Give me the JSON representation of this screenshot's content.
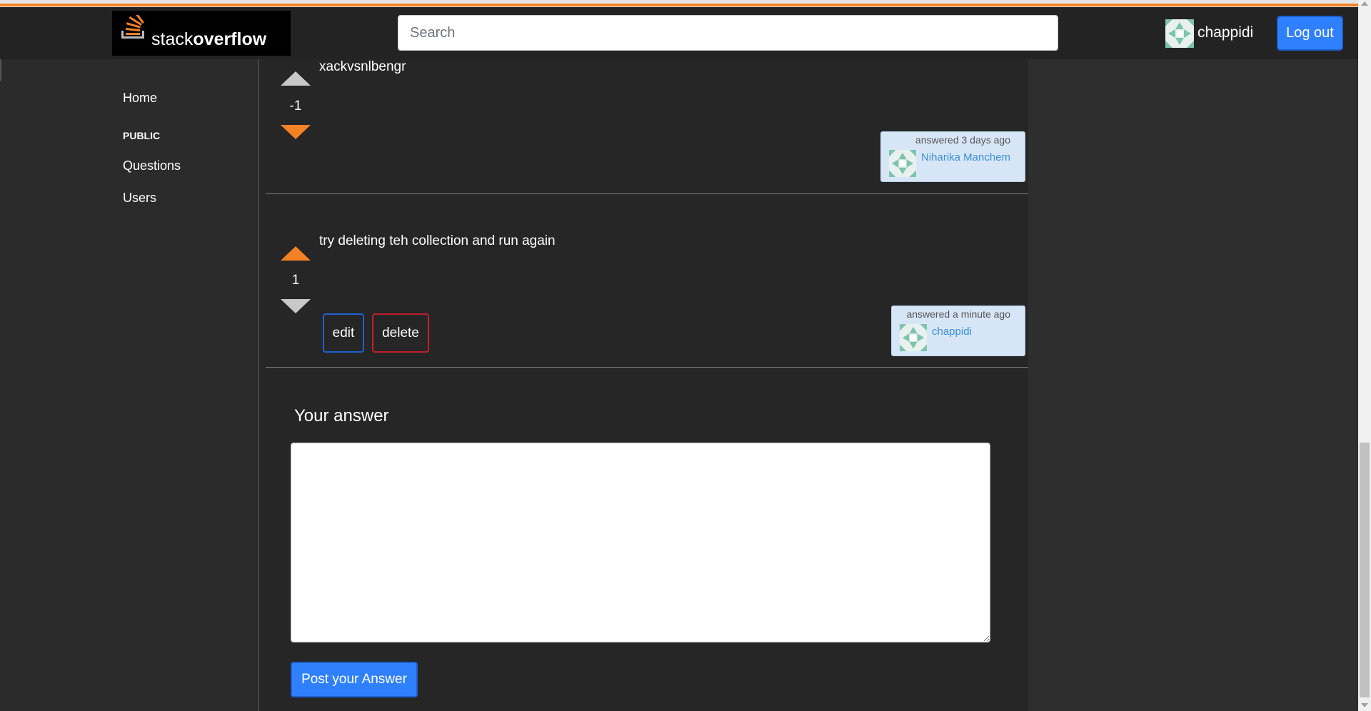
{
  "header": {
    "logo_text_light": "stack",
    "logo_text_bold": "overflow",
    "search_placeholder": "Search",
    "user_name": "chappidi",
    "logout_label": "Log out"
  },
  "sidebar": {
    "home": "Home",
    "section_label": "PUBLIC",
    "questions": "Questions",
    "users": "Users"
  },
  "answers": [
    {
      "text": "xackvsnlbengr",
      "votes": "-1",
      "upvoted": false,
      "downvoted": true,
      "answered": "answered 3 days ago",
      "author": "Niharika Manchem"
    },
    {
      "text": "try deleting teh collection and run again",
      "votes": "1",
      "upvoted": true,
      "downvoted": false,
      "answered": "answered a minute ago",
      "author": "chappidi",
      "edit_label": "edit",
      "delete_label": "delete"
    }
  ],
  "answer_form": {
    "heading": "Your answer",
    "textarea_value": "",
    "submit_label": "Post your Answer"
  },
  "colors": {
    "vote_active": "#f48225",
    "vote_inactive": "#c8c8c8",
    "accent_blue": "#2f80ff",
    "delete_red": "#c0202a"
  }
}
